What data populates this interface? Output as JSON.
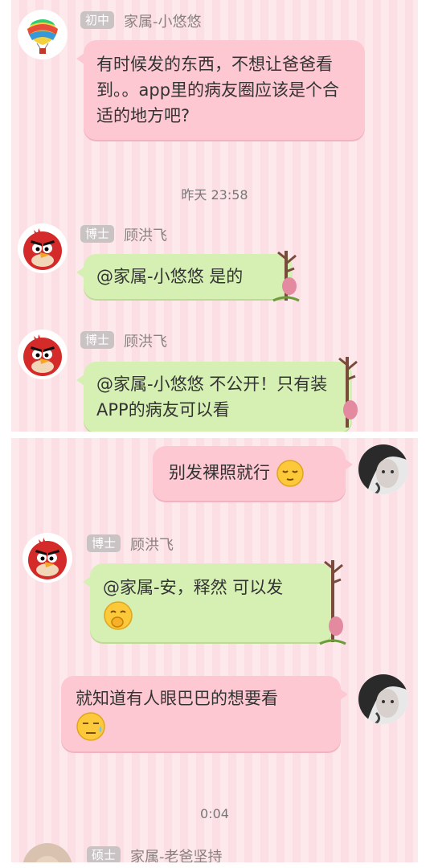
{
  "panel1": {
    "msg1": {
      "badge": "初中",
      "name": "家属-小悠悠",
      "text": "有时候发的东西，不想让爸爸看到。。app里的病友圈应该是个合适的地方吧?"
    },
    "time1": "昨天 23:58",
    "msg2": {
      "badge": "博士",
      "name": "顾洪飞",
      "text": "@家属-小悠悠 是的"
    },
    "msg3": {
      "badge": "博士",
      "name": "顾洪飞",
      "text": "@家属-小悠悠 不公开！只有装APP的病友可以看"
    }
  },
  "panel2": {
    "msg1": {
      "text": "别发裸照就行",
      "emoji": "relieved-face"
    },
    "msg2": {
      "badge": "博士",
      "name": "顾洪飞",
      "text": "@家属-安，释然 可以发",
      "emoji": "giggle-face"
    },
    "msg3": {
      "text": "就知道有人眼巴巴的想要看",
      "emoji": "sweat-face"
    },
    "time2": "0:04",
    "msg4": {
      "badge": "硕士",
      "name": "家属-老爸坚持"
    }
  },
  "colors": {
    "bubble_pink": "#fdc8d2",
    "bubble_green": "#d6f0b4",
    "background": "#fde8ec",
    "badge": "#c9c3c4"
  }
}
